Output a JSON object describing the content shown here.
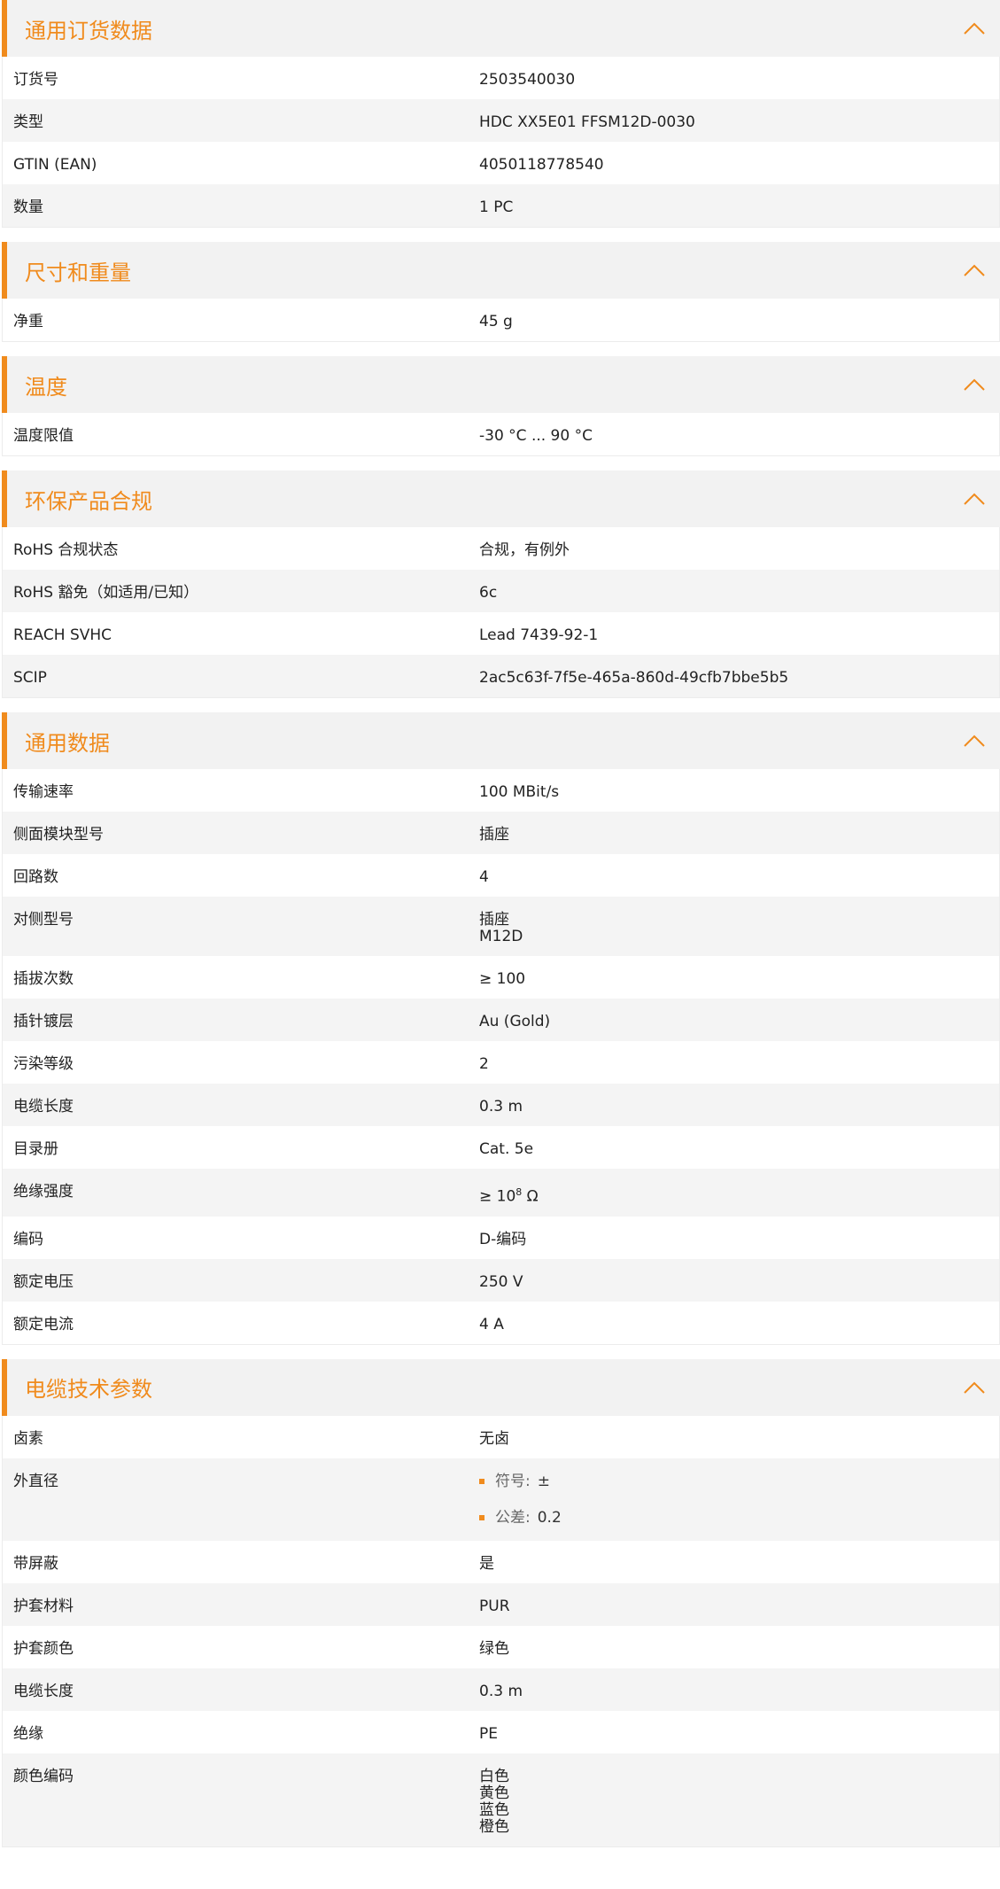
{
  "colors": {
    "accent": "#f08b1d",
    "header_bg": "#f2f2f2",
    "row_alt": "#f4f4f4"
  },
  "sections": [
    {
      "title": "通用订货数据",
      "rows": [
        {
          "k": "订货号",
          "v": [
            "2503540030"
          ]
        },
        {
          "k": "类型",
          "v": [
            "HDC XX5E01 FFSM12D-0030"
          ]
        },
        {
          "k": "GTIN (EAN)",
          "v": [
            "4050118778540"
          ]
        },
        {
          "k": "数量",
          "v": [
            "1  PC"
          ]
        }
      ]
    },
    {
      "title": "尺寸和重量",
      "rows": [
        {
          "k": "净重",
          "v": [
            "45  g"
          ]
        }
      ]
    },
    {
      "title": "温度",
      "rows": [
        {
          "k": "温度限值",
          "v": [
            "-30 °C ... 90 °C"
          ]
        }
      ]
    },
    {
      "title": "环保产品合规",
      "rows": [
        {
          "k": "RoHS 合规状态",
          "v": [
            "合规，有例外"
          ]
        },
        {
          "k": "RoHS 豁免（如适用/已知）",
          "v": [
            "6c"
          ]
        },
        {
          "k": "REACH SVHC",
          "v": [
            "Lead 7439-92-1"
          ]
        },
        {
          "k": "SCIP",
          "v": [
            "2ac5c63f-7f5e-465a-860d-49cfb7bbe5b5"
          ]
        }
      ]
    },
    {
      "title": "通用数据",
      "rows": [
        {
          "k": "传输速率",
          "v": [
            "100 MBit/s"
          ]
        },
        {
          "k": "侧面模块型号",
          "v": [
            "插座"
          ]
        },
        {
          "k": "回路数",
          "v": [
            "4"
          ]
        },
        {
          "k": "对侧型号",
          "v": [
            "插座",
            "M12D"
          ]
        },
        {
          "k": "插拔次数",
          "v": [
            "≥ 100"
          ]
        },
        {
          "k": "插针镀层",
          "v": [
            "Au (Gold)"
          ]
        },
        {
          "k": "污染等级",
          "v": [
            "2"
          ]
        },
        {
          "k": "电缆长度",
          "v": [
            "0.3  m"
          ]
        },
        {
          "k": "目录册",
          "v": [
            "Cat. 5e"
          ]
        },
        {
          "k": "绝缘强度",
          "sup_value": {
            "base": "≥ 10",
            "exp": "8",
            "unit": " Ω"
          }
        },
        {
          "k": "编码",
          "v": [
            "D-编码"
          ]
        },
        {
          "k": "额定电压",
          "v": [
            "250  V"
          ]
        },
        {
          "k": "额定电流",
          "v": [
            "4  A"
          ]
        }
      ]
    },
    {
      "title": "电缆技术参数",
      "rows": [
        {
          "k": "卤素",
          "v": [
            "无卤"
          ]
        },
        {
          "k": "外直径",
          "bullets": [
            {
              "label": "符号:",
              "value": "±"
            },
            {
              "label": "公差:",
              "value": "0.2"
            }
          ]
        },
        {
          "k": "带屏蔽",
          "v": [
            "是"
          ]
        },
        {
          "k": "护套材料",
          "v": [
            "PUR"
          ]
        },
        {
          "k": "护套颜色",
          "v": [
            "绿色"
          ]
        },
        {
          "k": "电缆长度",
          "v": [
            "0.3  m"
          ]
        },
        {
          "k": "绝缘",
          "v": [
            "PE"
          ]
        },
        {
          "k": "颜色编码",
          "v": [
            "白色",
            "黄色",
            "蓝色",
            "橙色"
          ]
        }
      ]
    }
  ]
}
